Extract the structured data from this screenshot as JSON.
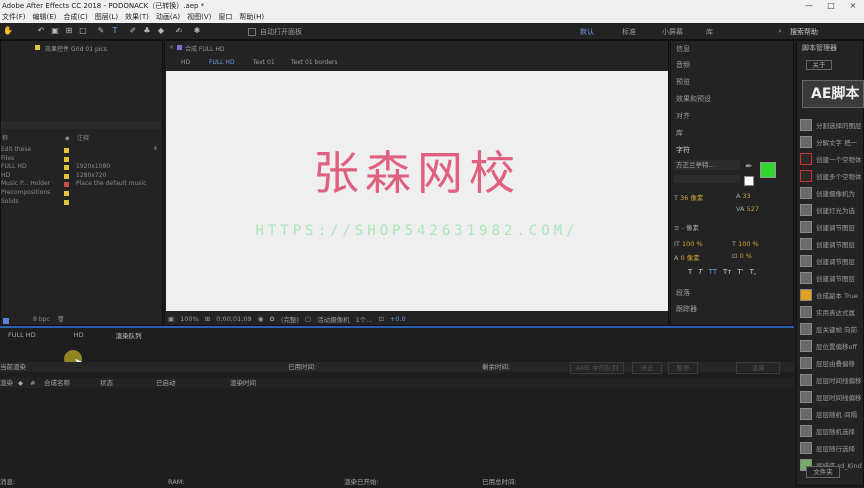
{
  "window": {
    "title": "Adobe After Effects CC 2018 - PODONACK（已转换）.aep *",
    "controls": [
      "—",
      "□",
      "×"
    ]
  },
  "menu": [
    "文件(F)",
    "编辑(E)",
    "合成(C)",
    "图层(L)",
    "效果(T)",
    "动画(A)",
    "视图(V)",
    "窗口",
    "帮助(H)"
  ],
  "toolbar": {
    "auto_open": "自动打开面板",
    "workspaces": [
      "默认",
      "标准",
      "小屏幕",
      "库"
    ],
    "search": "搜索帮助"
  },
  "left_panel": {
    "tab": "效果控件 Grid 01 pics",
    "col_name": "称",
    "col_comment": "注释",
    "rows": [
      {
        "name": "Edit these",
        "comment": "",
        "color": "yellow"
      },
      {
        "name": "Files",
        "comment": "",
        "color": "yellow"
      },
      {
        "name": "FULL HD",
        "comment": "1920x1080",
        "color": "yellow"
      },
      {
        "name": "HD",
        "comment": "1280x720",
        "color": "yellow"
      },
      {
        "name": "Music P... Holder",
        "comment": "Place the default music",
        "color": "red"
      },
      {
        "name": "Precompositions",
        "comment": "",
        "color": "yellow"
      },
      {
        "name": "Solids",
        "comment": "",
        "color": "yellow"
      }
    ],
    "bpc": "8 bpc"
  },
  "comp_panel": {
    "tab": "合成 FULL HD",
    "breadcrumbs": [
      "HD",
      "FULL HD",
      "Text 01",
      "Text 01 borders"
    ],
    "main_text": "张森网校",
    "url_text": "HTTPS://SHOP542631982.COM/",
    "zoom": "100%",
    "timecode": "0;00;01;09",
    "resolution": "(完整)",
    "camera": "活动摄像机",
    "views": "1个...",
    "exposure": "+0.0",
    "colors": {
      "main": "#e0607f",
      "url": "#a7e8b9",
      "canvas": "#efefef"
    }
  },
  "info_panel": {
    "items": [
      "信息",
      "音频",
      "预览",
      "效果和预设",
      "对齐",
      "库"
    ],
    "char_title": "字符",
    "font": "方正兰亭特...",
    "size": "36 像素",
    "leading": "33",
    "kerning": "527",
    "stroke": "- 像素",
    "vscale": "100 %",
    "hscale": "100 %",
    "baseline": "0 像素",
    "tsume": "0 %",
    "styles": [
      "T",
      "T",
      "TT",
      "Tт",
      "T'",
      "T,"
    ],
    "para": "段落",
    "tracker": "跟踪器",
    "swatch": "#31d631"
  },
  "script_panel": {
    "title": "脚本管理器",
    "about": "关于",
    "logo": "AE脚本",
    "items": [
      "分割选择的图层",
      "分解文字 把一",
      "创建一个空物体",
      "创建多个空物体",
      "创建摄像机为",
      "创建灯光为选",
      "创建调节图层",
      "创建调节图层",
      "创建调节图层",
      "创建调节图层",
      "合成副本 True",
      "实用表达式属",
      "层关键帧 向前",
      "层位置偏移off",
      "层层由叠偏移",
      "层层时间线偏移 pt",
      "层层时间线偏移",
      "层层随机 间隔",
      "层层随机选择",
      "层层随行选择",
      "层排序 rd_Kind"
    ],
    "folder": "文件夹"
  },
  "bottom": {
    "tabs": [
      "FULL HD",
      "HD",
      "渲染队列"
    ],
    "current_render": "当前渲染",
    "elapsed": "已用时间:",
    "remaining": "剩余时间:",
    "ame": "AME 中的队列",
    "stop": "停止",
    "pause": "暂停",
    "render": "渲染",
    "cols": [
      "渲染",
      "#",
      "合成名称",
      "状态",
      "已启动",
      "渲染时间"
    ],
    "msg": "消息:",
    "ram": "RAM:",
    "started": "渲染已开始:",
    "total": "已用总时间:"
  }
}
